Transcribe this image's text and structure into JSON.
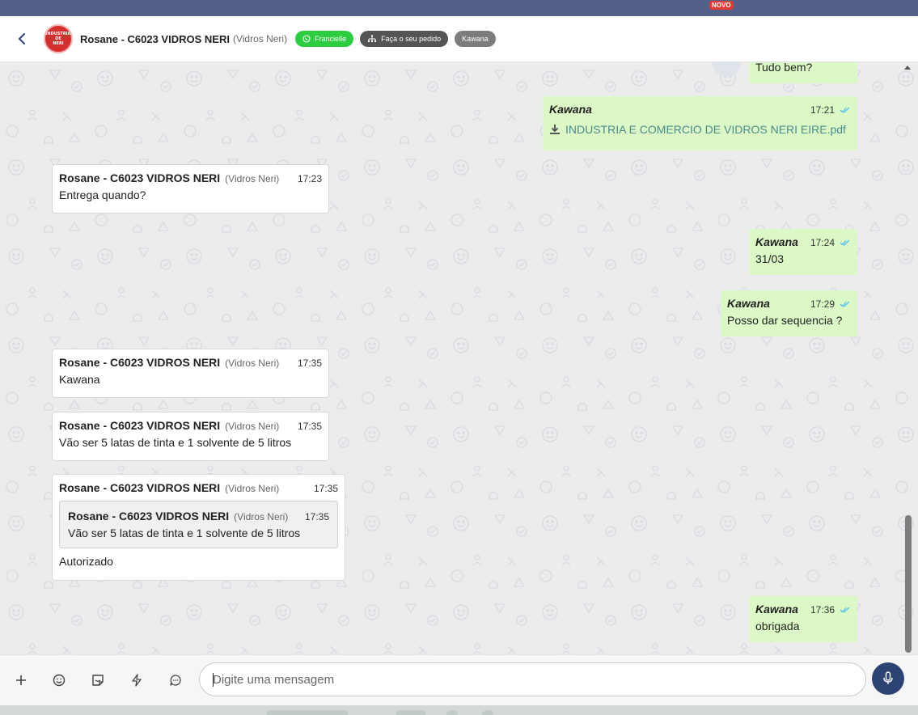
{
  "topbar": {
    "badge": "NOVO"
  },
  "header": {
    "contact_name": "Rosane - C6023 VIDROS NERI",
    "contact_company": "(Vidros Neri)",
    "avatar_text": [
      "INDUSTRIA",
      "DE",
      "NERI"
    ],
    "tags": [
      {
        "label": "Francielle",
        "icon": "whatsapp-icon",
        "color": "#2ecc40"
      },
      {
        "label": "Faça o seu pedido",
        "icon": "sitemap-icon",
        "color": "#555555"
      },
      {
        "label": "Kawana",
        "color": "#7c7c7c"
      }
    ]
  },
  "messages": [
    {
      "id": "m1",
      "direction": "out",
      "text": "Tudo bem?"
    },
    {
      "id": "m2",
      "direction": "out",
      "sender": "Kawana",
      "time": "17:21",
      "file": "INDUSTRIA E COMERCIO DE VIDROS NERI EIRE.pdf"
    },
    {
      "id": "m3",
      "direction": "in",
      "sender": "Rosane - C6023 VIDROS NERI",
      "company": "(Vidros Neri)",
      "time": "17:23",
      "text": "Entrega quando?"
    },
    {
      "id": "m4",
      "direction": "out",
      "sender": "Kawana",
      "time": "17:24",
      "text": "31/03"
    },
    {
      "id": "m5",
      "direction": "out",
      "sender": "Kawana",
      "time": "17:29",
      "text": "Posso dar sequencia ?"
    },
    {
      "id": "m6",
      "direction": "in",
      "sender": "Rosane - C6023 VIDROS NERI",
      "company": "(Vidros Neri)",
      "time": "17:35",
      "text": "Kawana"
    },
    {
      "id": "m7",
      "direction": "in",
      "sender": "Rosane - C6023 VIDROS NERI",
      "company": "(Vidros Neri)",
      "time": "17:35",
      "text": "Vão ser 5 latas de tinta e 1 solvente de 5 litros"
    },
    {
      "id": "m8",
      "direction": "in",
      "sender": "Rosane - C6023 VIDROS NERI",
      "company": "(Vidros Neri)",
      "time": "17:35",
      "quote": {
        "sender": "Rosane - C6023 VIDROS NERI",
        "company": "(Vidros Neri)",
        "time": "17:35",
        "text": "Vão ser 5 latas de tinta e 1 solvente de 5 litros"
      },
      "text": "Autorizado"
    },
    {
      "id": "m9",
      "direction": "out",
      "sender": "Kawana",
      "time": "17:36",
      "text": "obrigada"
    }
  ],
  "composer": {
    "placeholder": "Digite uma mensagem",
    "icons": [
      "plus-icon",
      "emoji-icon",
      "sticker-icon",
      "lightning-icon",
      "chat-bubble-icon",
      "microphone-icon"
    ]
  },
  "colors": {
    "topband": "#53608a",
    "outgoing_bubble": "#dcf8c6",
    "incoming_bubble": "#ffffff",
    "mic_button": "#2d4373",
    "read_ticks": "#53bdeb",
    "file_link": "#4a8b8b"
  }
}
